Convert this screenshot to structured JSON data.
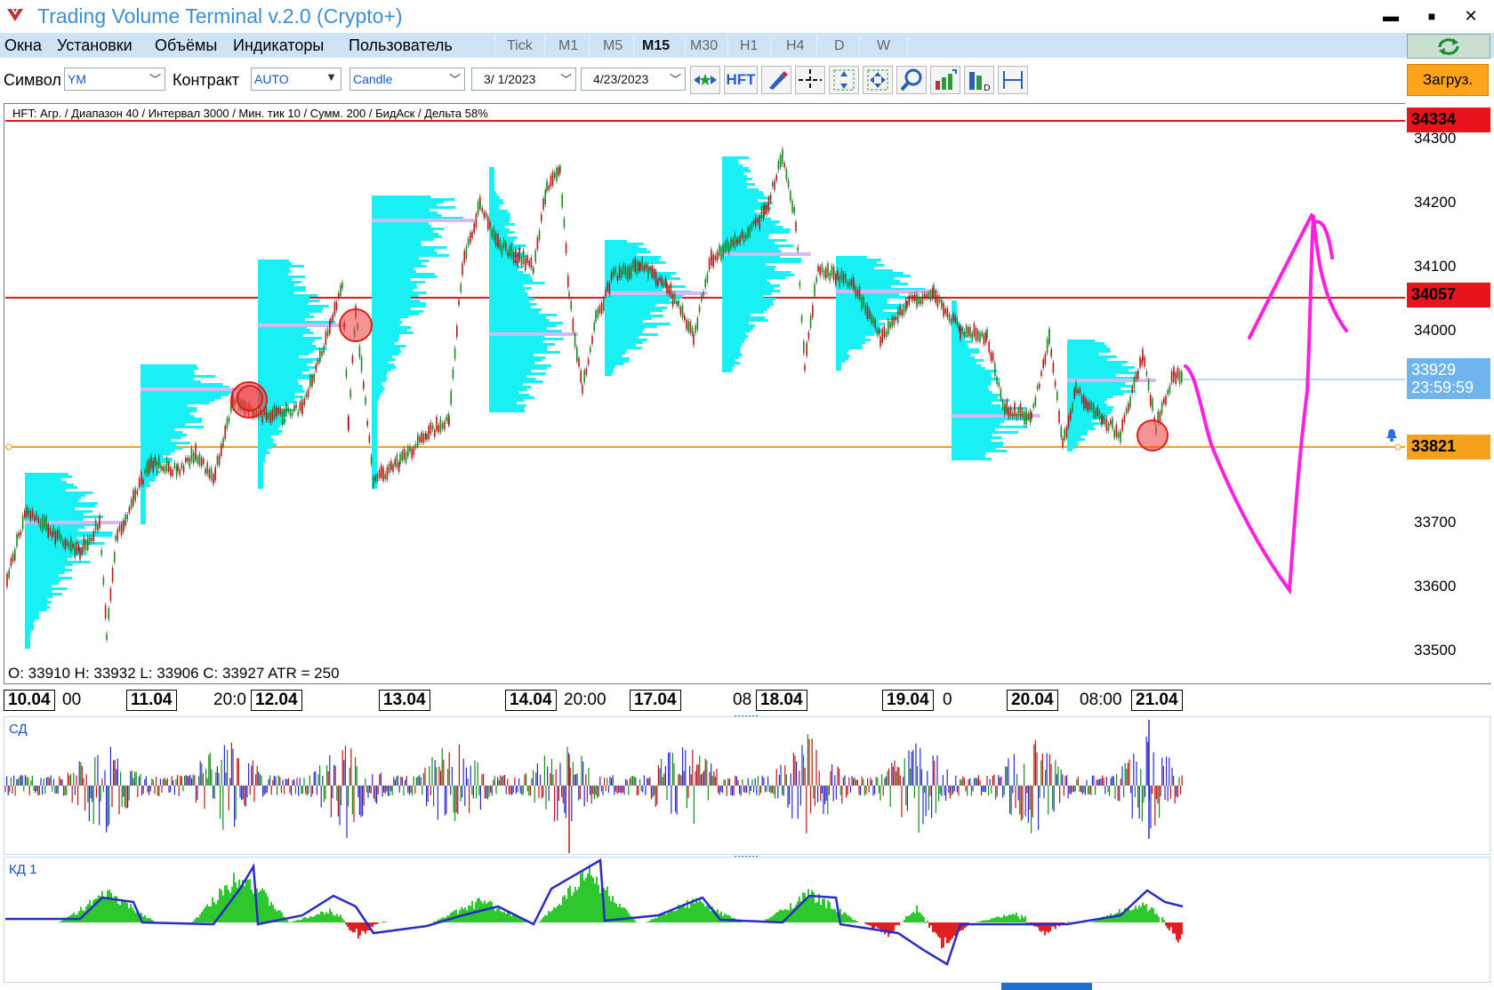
{
  "app": {
    "title": "Trading Volume Terminal v.2.0 (Crypto+)",
    "minimize": "▬",
    "maximize": "■",
    "close": "✕"
  },
  "menu": [
    "Окна",
    "Установки",
    "Объёмы",
    "Индикаторы",
    "Пользователь"
  ],
  "timeframes": [
    {
      "label": "Tick",
      "active": false
    },
    {
      "label": "M1",
      "active": false
    },
    {
      "label": "M5",
      "active": false
    },
    {
      "label": "M15",
      "active": true
    },
    {
      "label": "M30",
      "active": false
    },
    {
      "label": "H1",
      "active": false
    },
    {
      "label": "H4",
      "active": false
    },
    {
      "label": "D",
      "active": false
    },
    {
      "label": "W",
      "active": false
    }
  ],
  "toolbar": {
    "symbol_label": "Символ",
    "symbol_value": "YM",
    "contract_label": "Контракт",
    "contract_value": "AUTO",
    "chart_type": "Candle",
    "date_from": "3/  1/2023",
    "date_to": "4/23/2023",
    "hft_label": "HFT",
    "load_button": "Загруз."
  },
  "chart": {
    "info": "HFT: Агр. / Диапазон 40 / Интервал 3000 / Мин. тик 10 / Сумм. 200 / БидАск / Дельта 58%",
    "ohlc": "O: 33910   H: 33932   L: 33906   C: 33927   ATR = 250",
    "price_ticks": [
      "34300",
      "34200",
      "34100",
      "34000",
      "33700",
      "33600",
      "33500"
    ],
    "badges": {
      "high": "34334",
      "mid": "34057",
      "current_price": "33929",
      "countdown": "23:59:59",
      "low": "33821"
    },
    "colors": {
      "red_line": "#e8141c",
      "orange_line": "#f5a11c",
      "current_badge": "#6fb4ec",
      "profile": "#19f0f4",
      "annotation": "#ff1fe0",
      "bull": "#188a1a",
      "bear": "#c01414"
    }
  },
  "time_axis": {
    "dates": [
      "10.04",
      "11.04",
      "12.04",
      "13.04",
      "14.04",
      "17.04",
      "18.04",
      "19.04",
      "20.04",
      "21.04"
    ],
    "times": [
      "00",
      "20:0",
      "20:00",
      "08",
      "0",
      "08:00"
    ]
  },
  "indicators": {
    "cd_label": "СД",
    "kd_label": "КД 1"
  }
}
